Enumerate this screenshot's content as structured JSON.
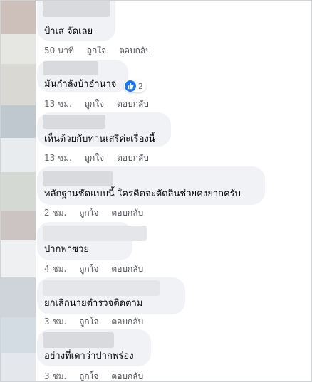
{
  "comments": [
    {
      "text": "ป้าเส จัดเลย",
      "time": "50 นาที",
      "like_label": "ถูกใจ",
      "reply_label": "ตอบกลับ",
      "avatar_color": "#cdbfb9"
    },
    {
      "text": "มันกำลังบ้าอำนาจ",
      "time": "13 ชม.",
      "like_label": "ถูกใจ",
      "reply_label": "ตอบกลับ",
      "reaction_count": "2",
      "avatar_color": "#d9d8d2"
    },
    {
      "text": "เห็นด้วยกับท่านเสรีค่ะเรื่องนี้",
      "time": "13 ชม.",
      "like_label": "ถูกใจ",
      "reply_label": "ตอบกลับ",
      "avatar_color": "#bfc7cf"
    },
    {
      "text": "หลักฐานชัดแบบนี้ ใครคิดจะตัดสินช่วยคงยากครับ",
      "time": "2 ชม.",
      "like_label": "ถูกใจ",
      "reply_label": "ตอบกลับ",
      "avatar_color": "#d5d9d3"
    },
    {
      "text": "ปากพาซวย",
      "time": "4 ชม.",
      "like_label": "ถูกใจ",
      "reply_label": "ตอบกลับ",
      "avatar_color": "#cbc4c2"
    },
    {
      "text": "ยกเลิกนายตำรวจติดตาม",
      "time": "3 ชม.",
      "like_label": "ถูกใจ",
      "reply_label": "ตอบกลับ",
      "avatar_color": "#cfd4da"
    },
    {
      "text": "อย่างที่เดาว่าปากพร่อง",
      "time": "3 ชม.",
      "like_label": "ถูกใจ",
      "reply_label": "ตอบกลับ",
      "avatar_color": "#d3dbe3"
    }
  ],
  "colors": {
    "bubble": "#f0f2f5",
    "meta_text": "#65676b",
    "like_blue": "#1877f2"
  },
  "icons": {
    "reaction": "thumbs-up-icon"
  }
}
